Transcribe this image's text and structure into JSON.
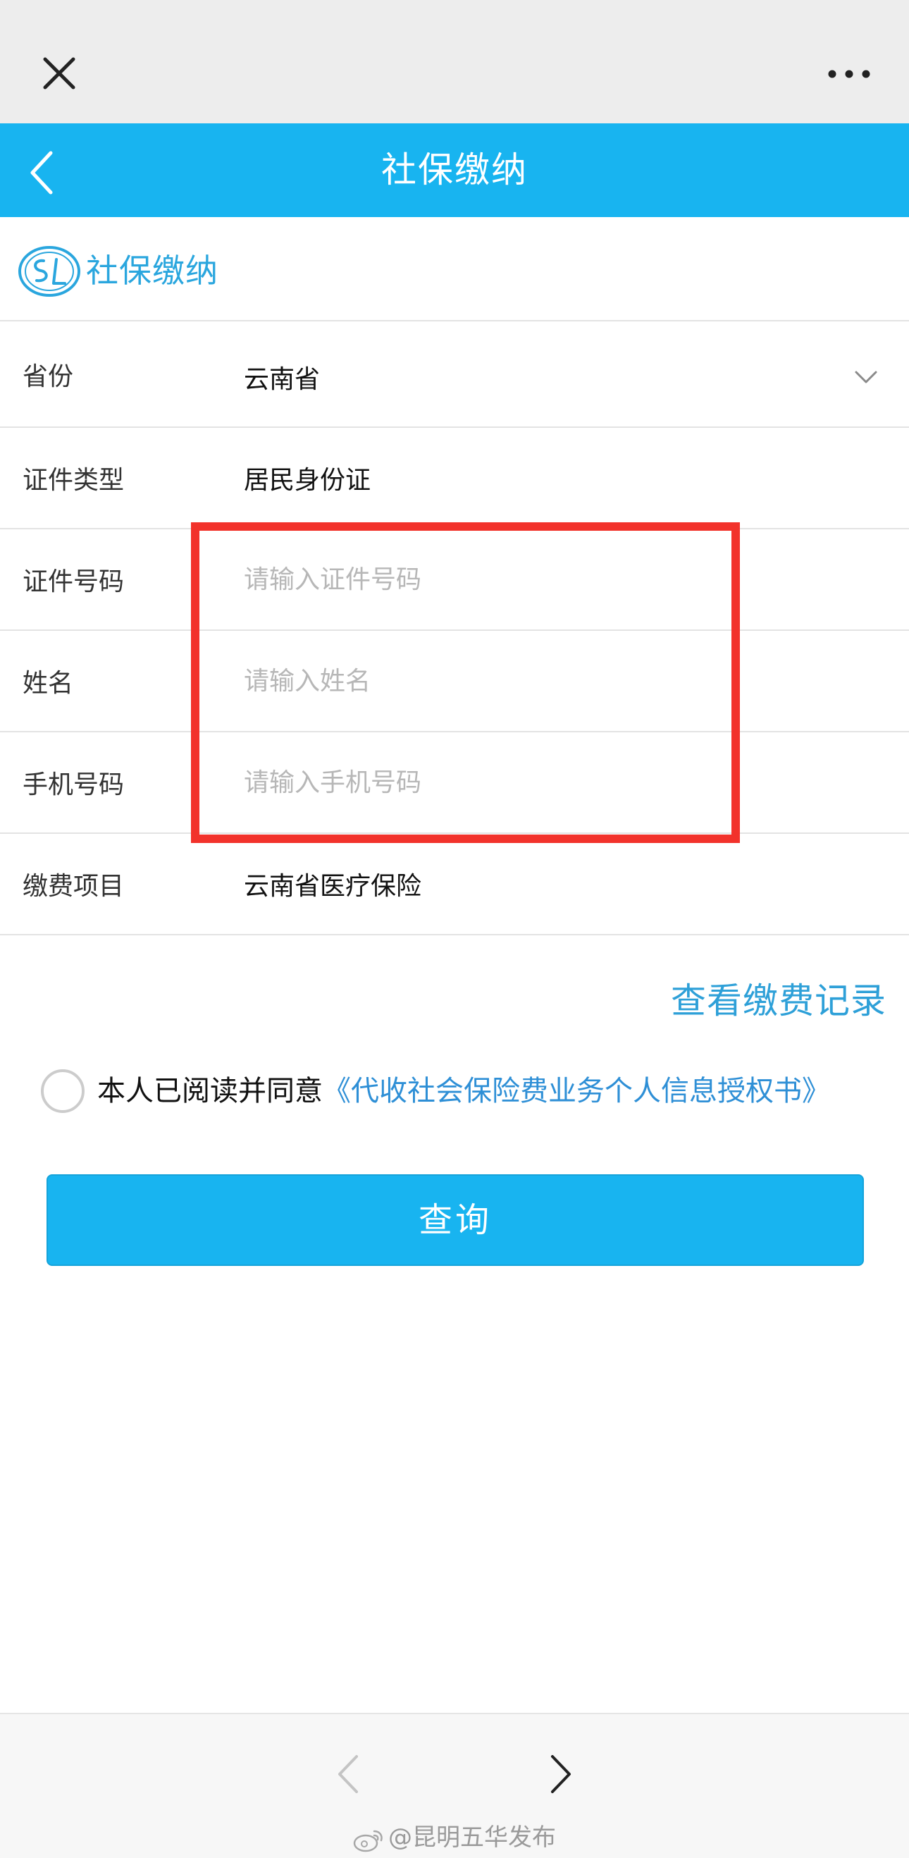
{
  "window": {
    "close_icon": "close-icon",
    "more_icon": "more-dots-icon"
  },
  "header": {
    "back_icon": "chevron-left-icon",
    "title": "社保缴纳"
  },
  "brand": {
    "logo_icon": "si-logo-icon",
    "text": "社保缴纳"
  },
  "form": {
    "province": {
      "label": "省份",
      "value": "云南省",
      "icon": "chevron-down-icon"
    },
    "id_type": {
      "label": "证件类型",
      "value": "居民身份证"
    },
    "id_number": {
      "label": "证件号码",
      "value": "",
      "placeholder": "请输入证件号码"
    },
    "name": {
      "label": "姓名",
      "value": "",
      "placeholder": "请输入姓名"
    },
    "phone": {
      "label": "手机号码",
      "value": "",
      "placeholder": "请输入手机号码"
    },
    "item": {
      "label": "缴费项目",
      "value": "云南省医疗保险"
    }
  },
  "highlight_color": "#f2322b",
  "records_link": "查看缴费记录",
  "agreement": {
    "checked": false,
    "prefix": "本人已阅读并同意",
    "link": "《代收社会保险费业务个人信息授权书》"
  },
  "query_button": "查询",
  "colors": {
    "accent": "#18b4f0",
    "link": "#2ea0d8"
  },
  "bottom_nav": {
    "back_icon": "chevron-left-icon",
    "forward_icon": "chevron-right-icon"
  },
  "watermark": {
    "icon": "weibo-icon",
    "text": "@昆明五华发布"
  }
}
